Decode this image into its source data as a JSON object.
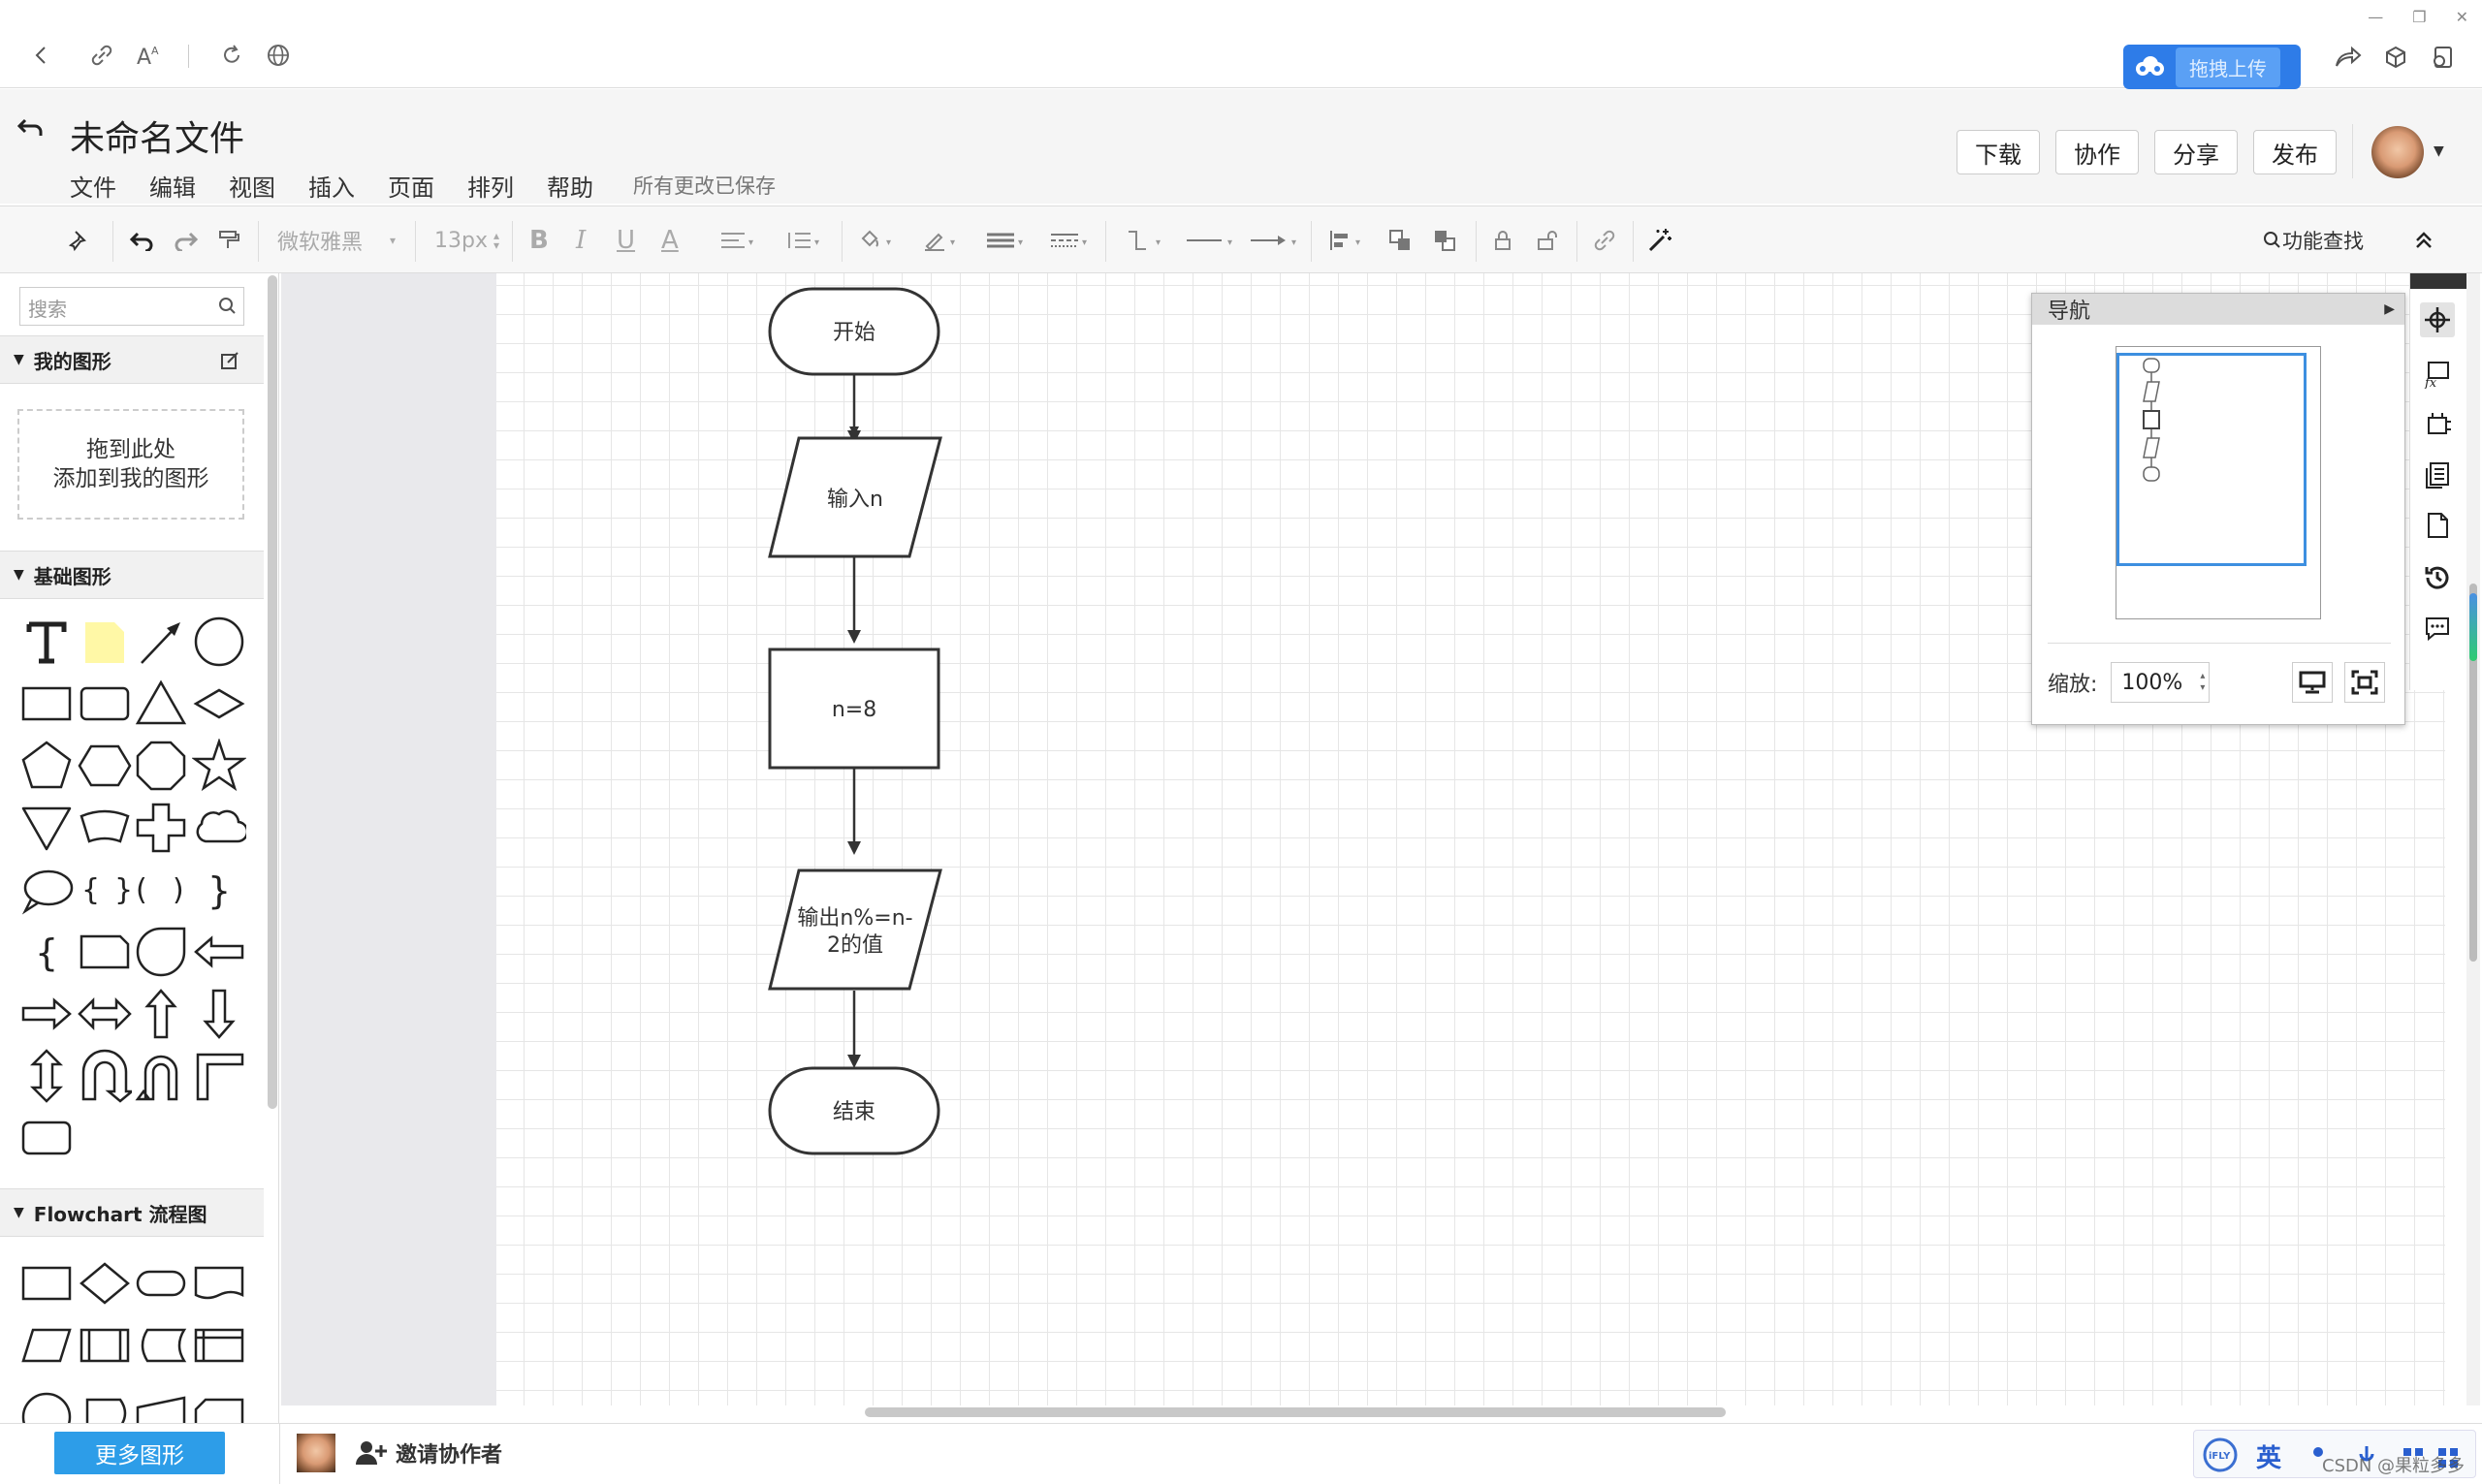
{
  "browser": {
    "icons": [
      "back-arrow-icon",
      "link-icon",
      "font-size-icon",
      "refresh-icon",
      "globe-icon",
      "share-icon",
      "cube-icon",
      "user-box-icon"
    ],
    "upload_label": "拖拽上传",
    "window_controls": [
      "—",
      "❐",
      "✕"
    ]
  },
  "header": {
    "doc_title": "未命名文件",
    "menu": [
      "文件",
      "编辑",
      "视图",
      "插入",
      "页面",
      "排列",
      "帮助"
    ],
    "save_status": "所有更改已保存",
    "buttons": {
      "download": "下载",
      "collab": "协作",
      "share": "分享",
      "publish": "发布"
    }
  },
  "toolbar": {
    "font_family": "微软雅黑",
    "font_size": "13px",
    "bold": "B",
    "italic": "I",
    "underline": "U",
    "font_color": "A",
    "feature_search": "功能查找"
  },
  "left_panel": {
    "search_placeholder": "搜索",
    "my_shapes_title": "我的图形",
    "dropzone_line1": "拖到此处",
    "dropzone_line2": "添加到我的图形",
    "basic_shapes_title": "基础图形",
    "flowchart_title": "Flowchart 流程图",
    "more_shapes": "更多图形"
  },
  "flowchart": {
    "nodes": [
      {
        "id": "start",
        "type": "terminator",
        "label": "开始"
      },
      {
        "id": "input",
        "type": "io",
        "label": "输入n"
      },
      {
        "id": "process",
        "type": "process",
        "label": "n=8"
      },
      {
        "id": "output",
        "type": "io",
        "label_line1": "输出n%=n-",
        "label_line2": "2的值"
      },
      {
        "id": "end",
        "type": "terminator",
        "label": "结束"
      }
    ]
  },
  "navigator": {
    "title": "导航",
    "zoom_label": "缩放:",
    "zoom_value": "100%"
  },
  "bottom": {
    "invite_label": "邀请协作者",
    "ime_label": "英",
    "watermark": "CSDN @果粒多多"
  },
  "colors": {
    "accent": "#2d9de8",
    "upload_bg": "#2e7ce8",
    "grid": "#e6e6e6",
    "canvas_gray": "#e9e9ec"
  }
}
